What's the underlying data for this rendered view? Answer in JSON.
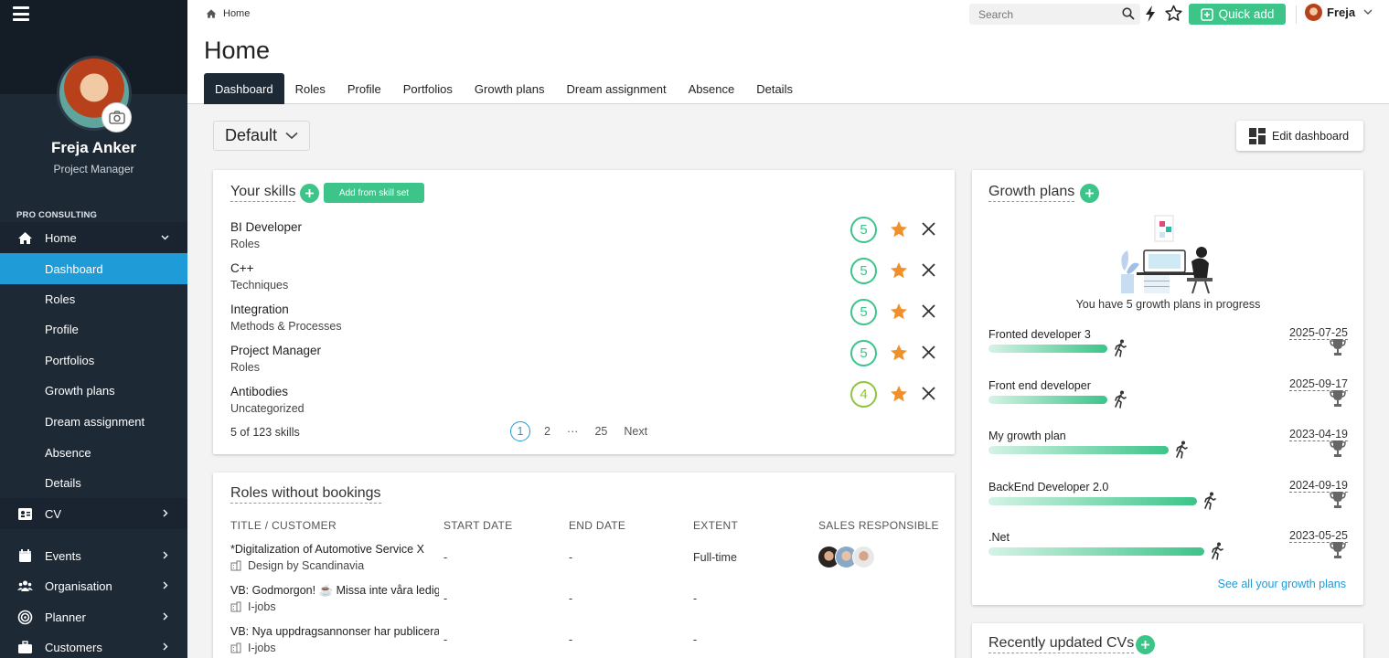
{
  "header": {
    "breadcrumb": "Home",
    "page_title": "Home",
    "search_placeholder": "Search",
    "quick_add_label": "Quick add",
    "user_name": "Freja",
    "tabs": [
      "Dashboard",
      "Roles",
      "Profile",
      "Portfolios",
      "Growth plans",
      "Dream assignment",
      "Absence",
      "Details"
    ],
    "active_tab": "Dashboard"
  },
  "sidebar": {
    "profile_name": "Freja Anker",
    "profile_role": "Project Manager",
    "section_label": "PRO CONSULTING",
    "items": [
      {
        "label": "Home",
        "icon": "home-icon"
      },
      {
        "label": "Dashboard"
      },
      {
        "label": "Roles"
      },
      {
        "label": "Profile"
      },
      {
        "label": "Portfolios"
      },
      {
        "label": "Growth plans"
      },
      {
        "label": "Dream assignment"
      },
      {
        "label": "Absence"
      },
      {
        "label": "Details"
      },
      {
        "label": "CV",
        "icon": "cv-icon"
      },
      {
        "label": "Events",
        "icon": "calendar-icon"
      },
      {
        "label": "Organisation",
        "icon": "people-icon"
      },
      {
        "label": "Planner",
        "icon": "target-icon"
      },
      {
        "label": "Customers",
        "icon": "briefcase-icon"
      }
    ],
    "active_item": "Dashboard"
  },
  "toolbar": {
    "dashboard_select": "Default",
    "edit_dashboard_label": "Edit dashboard"
  },
  "skills": {
    "title": "Your skills",
    "add_from_skillset_label": "Add from skill set",
    "items": [
      {
        "name": "BI Developer",
        "category": "Roles",
        "level": "5"
      },
      {
        "name": "C++",
        "category": "Techniques",
        "level": "5"
      },
      {
        "name": "Integration",
        "category": "Methods & Processes",
        "level": "5"
      },
      {
        "name": "Project Manager",
        "category": "Roles",
        "level": "5"
      },
      {
        "name": "Antibodies",
        "category": "Uncategorized",
        "level": "4"
      }
    ],
    "count_text": "5 of 123 skills",
    "pager": {
      "current": "1",
      "second": "2",
      "ellipsis": "···",
      "last": "25",
      "next": "Next"
    }
  },
  "roles": {
    "title": "Roles without bookings",
    "headers": [
      "TITLE / CUSTOMER",
      "START DATE",
      "END DATE",
      "EXTENT",
      "SALES RESPONSIBLE"
    ],
    "rows": [
      {
        "title": "*Digitalization of Automotive Service X",
        "customer": "Design by Scandinavia",
        "start": "-",
        "end": "-",
        "extent": "Full-time"
      },
      {
        "title": "VB: Godmorgon! ☕ Missa inte våra lediga",
        "customer": "I-jobs",
        "start": "-",
        "end": "-",
        "extent": "-"
      },
      {
        "title": "VB: Nya uppdragsannonser har publicerats",
        "customer": "I-jobs",
        "start": "-",
        "end": "-",
        "extent": "-"
      }
    ]
  },
  "growth": {
    "title": "Growth plans",
    "message": "You have 5 growth plans in progress",
    "plans": [
      {
        "name": "Fronted developer 3",
        "date": "2025-07-25",
        "progress": 0.33
      },
      {
        "name": "Front end developer",
        "date": "2025-09-17",
        "progress": 0.33
      },
      {
        "name": "My growth plan",
        "date": "2023-04-19",
        "progress": 0.5
      },
      {
        "name": "BackEnd Developer 2.0",
        "date": "2024-09-19",
        "progress": 0.58
      },
      {
        "name": ".Net",
        "date": "2023-05-25",
        "progress": 0.6
      }
    ],
    "see_all_label": "See all your growth plans"
  },
  "recent_cvs": {
    "title": "Recently updated CVs"
  },
  "colors": {
    "sidebar_bg": "#1e2936",
    "accent_blue": "#1f9bd7",
    "accent_green": "#3cc489",
    "star_orange": "#f0902a"
  }
}
